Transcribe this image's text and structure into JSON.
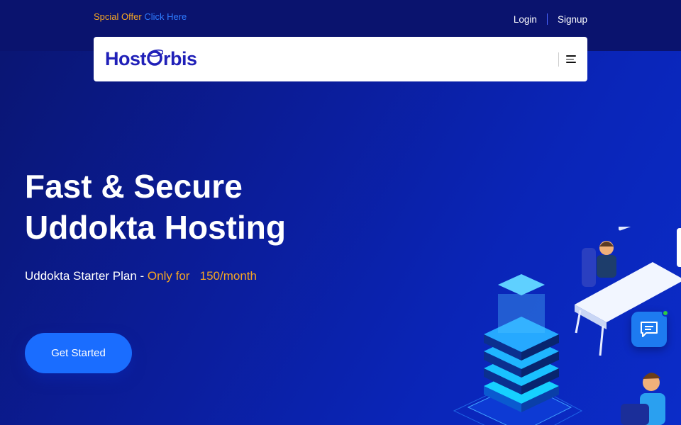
{
  "topbar": {
    "offer_text": "Spcial Offer",
    "offer_link": "Click Here",
    "login": "Login",
    "signup": "Signup"
  },
  "nav": {
    "logo_part1": "Host",
    "logo_part2": "rbis",
    "menu_icon": "hamburger-icon"
  },
  "hero": {
    "title_line1": "Fast & Secure",
    "title_line2": "Uddokta Hosting",
    "subtitle": "Uddokta Starter Plan - ",
    "price_prefix": "Only for",
    "price": "150/month",
    "cta": "Get Started"
  },
  "widgets": {
    "chat_icon": "chat-icon"
  },
  "colors": {
    "accent": "#f5a623",
    "primary": "#1a6dff",
    "brand": "#2020b8",
    "background": "#0a1e9f"
  }
}
